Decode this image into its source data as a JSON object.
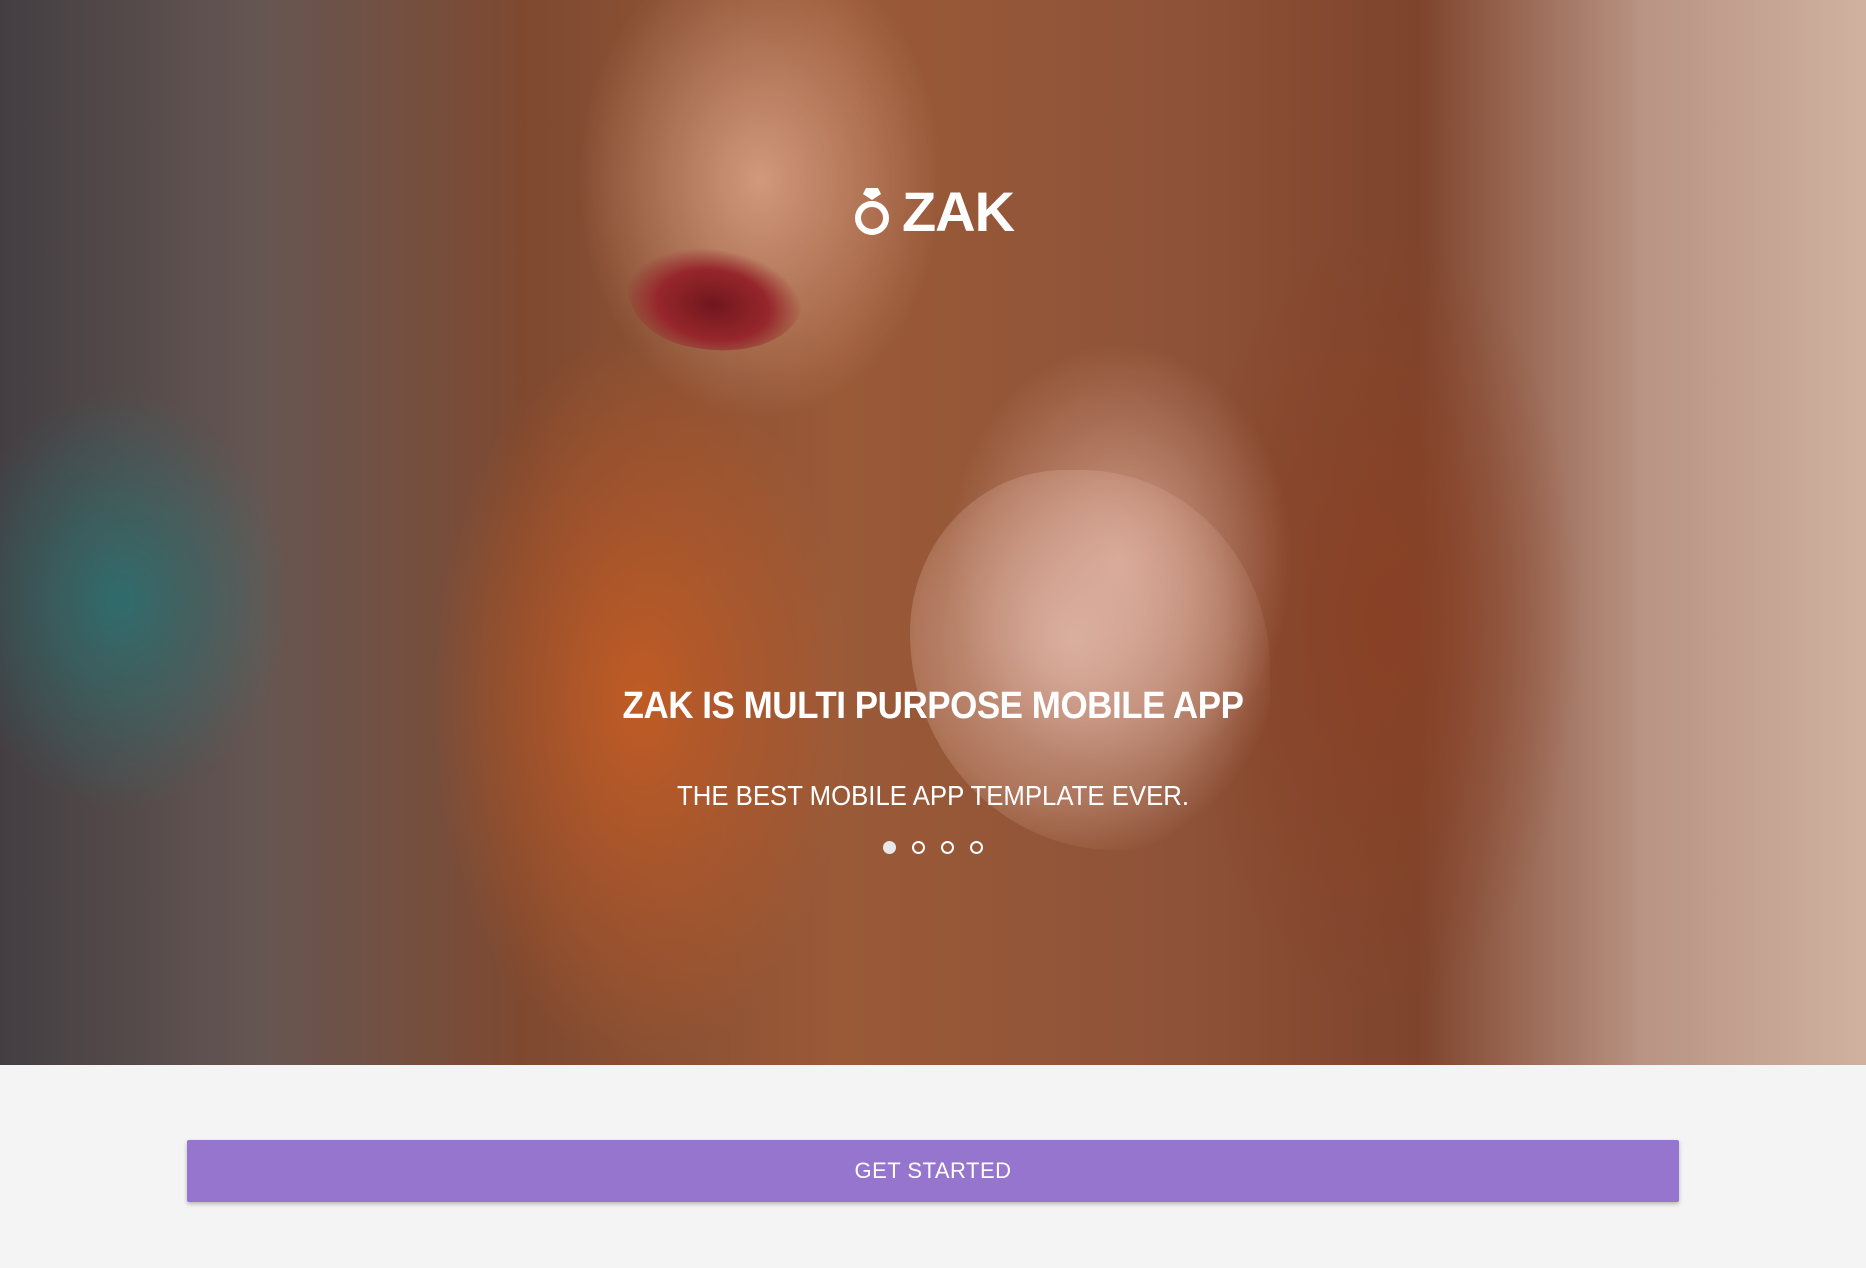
{
  "hero": {
    "background_image": "portrait-photo-woman-long-hair",
    "brand": {
      "icon": "ring-icon",
      "name": "ZAK"
    },
    "headline": "ZAK IS MULTI PURPOSE MOBILE APP",
    "subline": "THE BEST MOBILE APP TEMPLATE EVER.",
    "slider": {
      "total": 4,
      "active_index": 0
    }
  },
  "actions": {
    "get_started_label": "GET STARTED"
  },
  "colors": {
    "accent": "#9575cd",
    "page_background": "#f4f4f4",
    "text_on_dark": "#ffffff"
  }
}
